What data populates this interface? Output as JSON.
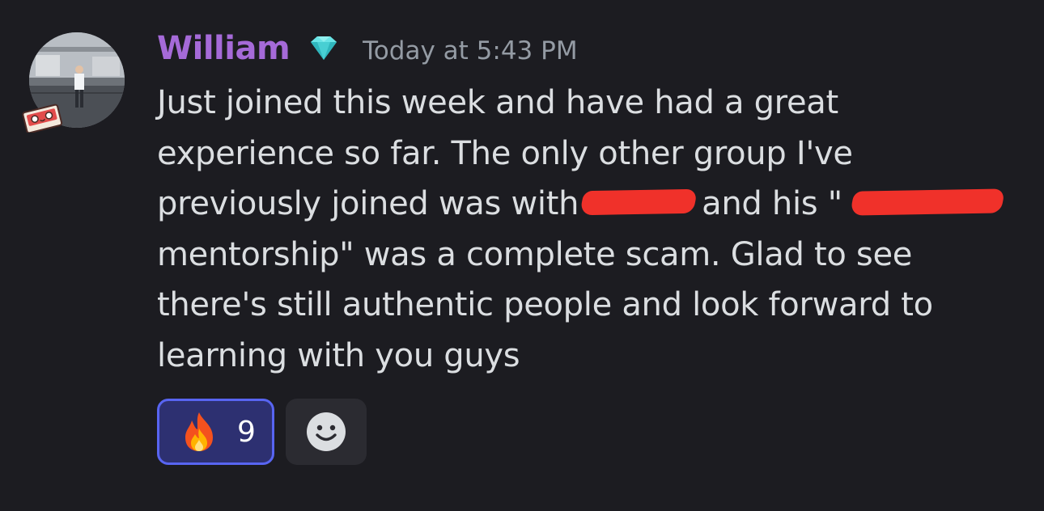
{
  "message": {
    "author": "William",
    "author_color": "#a56ad8",
    "badge_icon": "gem-icon",
    "timestamp": "Today at 5:43 PM",
    "lines": [
      "Just joined this week and have had a great",
      "experience so far. The only other group I've",
      "previously joined was with",
      "and his \"",
      "mentorship\" was a complete scam. Glad to see",
      "there's still authentic people and look forward to",
      "learning with you guys"
    ]
  },
  "reactions": [
    {
      "emoji": "fire-icon",
      "count": "9",
      "active": true,
      "accent": "#5865f2"
    }
  ],
  "add_reaction_icon": "smile-icon"
}
